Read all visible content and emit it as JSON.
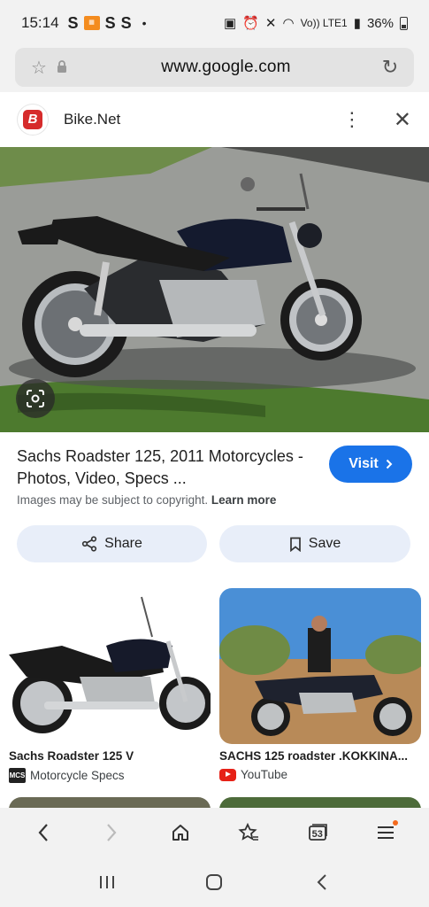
{
  "status_bar": {
    "time": "15:14",
    "s1": "S",
    "s2": "S",
    "s3": "S",
    "network": "Vo)) LTE1",
    "battery": "36%"
  },
  "url_bar": {
    "url": "www.google.com"
  },
  "panel": {
    "site_name": "Bike.Net",
    "logo_letter": "B"
  },
  "result": {
    "title": "Sachs Roadster 125, 2011 Motorcycles - Photos, Video, Specs ...",
    "visit_label": "Visit",
    "copyright_text": "Images may be subject to copyright.",
    "learn_more": "Learn more",
    "share_label": "Share",
    "save_label": "Save"
  },
  "related": [
    {
      "title": "Sachs Roadster 125 V",
      "source": "Motorcycle Specs",
      "source_icon": "MCS"
    },
    {
      "title": "SACHS 125 roadster .KOKKINA...",
      "source": "YouTube",
      "source_icon": "youtube-icon"
    }
  ],
  "toolbar": {
    "tabs_count": "53"
  },
  "colors": {
    "accent": "#1a73e8",
    "chip_bg": "#e8eef9",
    "bar_bg": "#f2f2f2"
  }
}
